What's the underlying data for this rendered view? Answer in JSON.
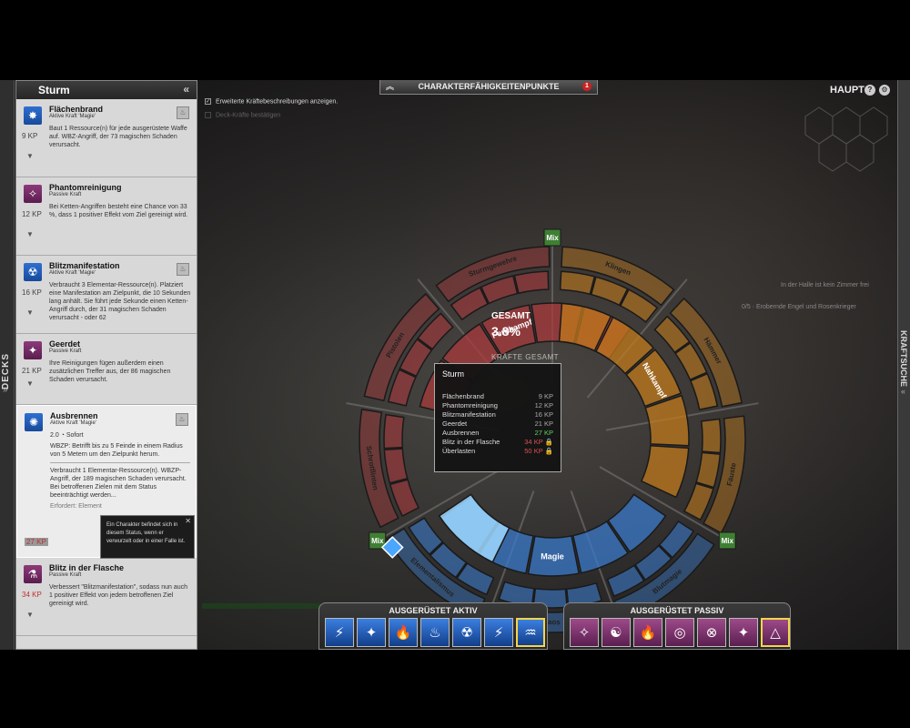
{
  "top": {
    "title": "CHARAKTERFÄHIGKEITENPUNKTE",
    "badge": "1",
    "view": "HAUPT",
    "help": "?",
    "settings": "⚙"
  },
  "options": {
    "option1": "Erweiterte Kräftebeschreibungen anzeigen.",
    "option2": "Deck-Kräfte bestätigen"
  },
  "left_strip": {
    "label": "DECKS"
  },
  "right_strip": {
    "label": "KRAFTSUCHE"
  },
  "panel": {
    "title": "Sturm",
    "cards": [
      {
        "title": "Flächenbrand",
        "type": "Aktive Kraft 'Magie'",
        "cost": "9 KP",
        "desc": "Baut 1 Ressource(n) für jede ausgerüstete Waffe auf. WBZ-Angriff, der 73 magischen Schaden verursacht."
      },
      {
        "title": "Phantomreinigung",
        "type": "Passive Kraft",
        "cost": "12 KP",
        "desc": "Bei Ketten-Angriffen besteht eine Chance von 33 %, dass 1 positiver Effekt vom Ziel gereinigt wird."
      },
      {
        "title": "Blitzmanifestation",
        "type": "Aktive Kraft 'Magie'",
        "cost": "16 KP",
        "desc": "Verbraucht 3 Elementar-Ressource(n). Platziert eine Manifestation am Zielpunkt, die 10 Sekunden lang anhält. Sie führt jede Sekunde einen Ketten-Angriff durch, der 31 magischen Schaden verursacht - oder 62"
      },
      {
        "title": "Geerdet",
        "type": "Passive Kraft",
        "cost": "21 KP",
        "desc": "Ihre Reinigungen fügen außerdem einen zusätzlichen Treffer aus, der 86 magischen Schaden verursacht."
      },
      {
        "title": "Ausbrennen",
        "type": "Aktive Kraft 'Magie'",
        "cost": "27 KP",
        "cast": "2.0",
        "cast_mode": "Sofort",
        "line1": "WBZP: Betrifft bis zu 5 Feinde in einem Radius von 5 Metern um den Zielpunkt herum.",
        "line2": "Verbraucht 1 Elementar-Ressource(n). WBZP-Angriff, der 189 magischen Schaden verursacht. Bei betroffenen Zielen mit dem Status beeinträchtigt werden...",
        "line3": "Erfordert: Element"
      },
      {
        "title": "Blitz in der Flasche",
        "type": "Passive Kraft",
        "cost": "34 KP",
        "desc": "Verbessert \"Blitzmanifestation\", sodass nun auch 1 positiver Effekt von jedem betroffenen Ziel gereinigt wird."
      }
    ]
  },
  "status_tooltip": {
    "text": "Ein Charakter befindet sich in diesem Status, wenn er verwurzelt oder in einer Falle ist.",
    "close": "✕"
  },
  "wheel": {
    "total_label": "GESAMT",
    "total_value": "3.8%",
    "powers_total": "KRÄFTE GESAMT",
    "mix_label": "Mix",
    "segments": [
      "Sturmgewehre",
      "Klingen",
      "Hämmer",
      "Fäuste",
      "Blutmagie",
      "Chaos",
      "Elementalismus",
      "Schrotflinten",
      "Pistolen"
    ],
    "categories": [
      "Fernkampf",
      "Nahkampf",
      "Magie"
    ]
  },
  "deck_tooltip": {
    "title": "Sturm",
    "rows": [
      {
        "name": "Flächenbrand",
        "kp": "9 KP"
      },
      {
        "name": "Phantomreinigung",
        "kp": "12 KP"
      },
      {
        "name": "Blitzmanifestation",
        "kp": "16 KP"
      },
      {
        "name": "Geerdet",
        "kp": "21 KP"
      },
      {
        "name": "Ausbrennen",
        "kp": "27 KP"
      },
      {
        "name": "Blitz in der Flasche",
        "kp": "34 KP"
      },
      {
        "name": "Überlasten",
        "kp": "50 KP"
      }
    ]
  },
  "active_bar": {
    "label": "AUSGERÜSTET AKTIV",
    "slots": [
      "⚡",
      "✦",
      "🔥",
      "♨",
      "☢",
      "⚡",
      "♒"
    ]
  },
  "passive_bar": {
    "label": "AUSGERÜSTET PASSIV",
    "slots": [
      "✧",
      "☯",
      "🔥",
      "◎",
      "⊗",
      "✦",
      "△"
    ]
  },
  "colors": {
    "ranged": "#a8393c",
    "melee": "#c0791c",
    "magic": "#3a79c9",
    "mix": "#3f7f34"
  }
}
